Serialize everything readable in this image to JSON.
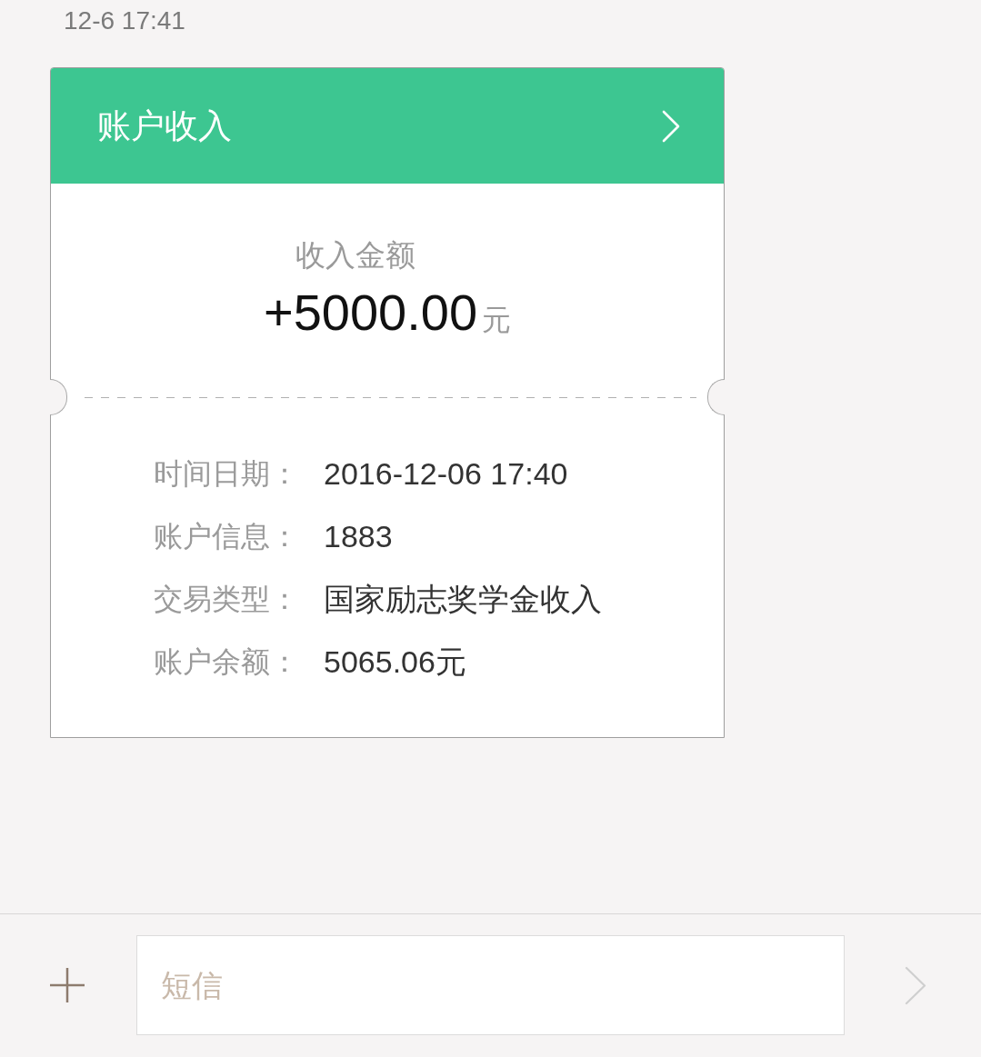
{
  "message_time": "12-6 17:41",
  "card": {
    "title": "账户收入",
    "amount_label": "收入金额",
    "amount": "+5000.00",
    "amount_unit": "元",
    "details": [
      {
        "label": "时间日期：",
        "value": "2016-12-06 17:40"
      },
      {
        "label": "账户信息：",
        "value": "1883"
      },
      {
        "label": "交易类型：",
        "value": "国家励志奖学金收入"
      },
      {
        "label": "账户余额：",
        "value": "5065.06元"
      }
    ]
  },
  "composer": {
    "placeholder": "短信"
  }
}
